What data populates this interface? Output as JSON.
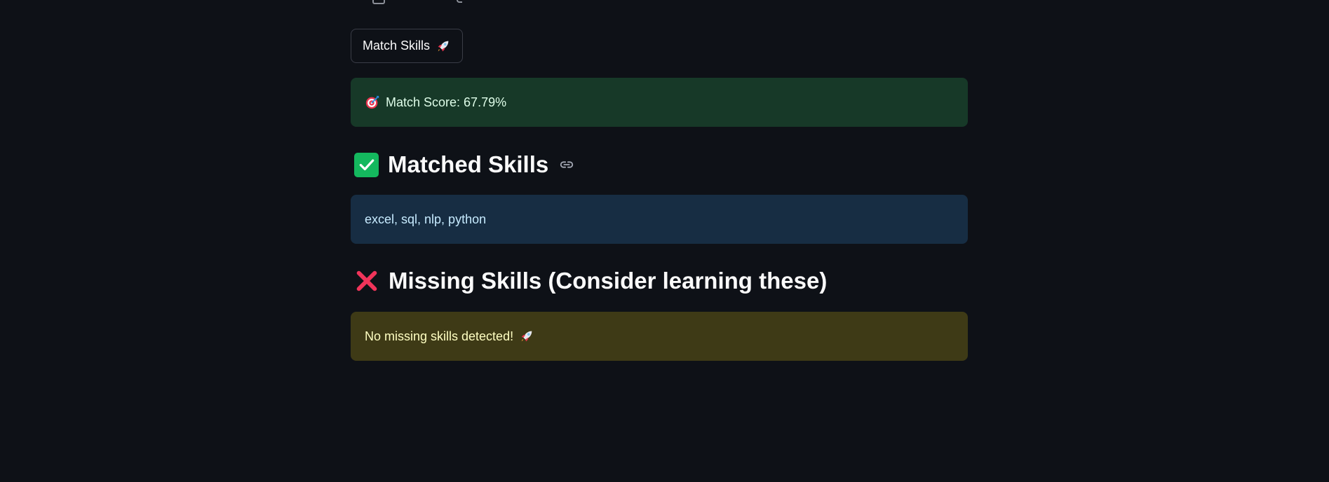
{
  "match_button": {
    "label": "Match Skills",
    "icon": "rocket-icon"
  },
  "score_alert": {
    "icon": "target-icon",
    "text": "Match Score: 67.79%"
  },
  "matched_section": {
    "icon": "check-mark-icon",
    "title": "Matched Skills",
    "anchor_icon": "link-icon",
    "skills_text": "excel, sql, nlp, python"
  },
  "missing_section": {
    "icon": "cross-mark-icon",
    "title": "Missing Skills (Consider learning these)",
    "message": "No missing skills detected!",
    "message_icon": "rocket-icon"
  },
  "colors": {
    "background": "#0e1117",
    "success_bg": "#173928",
    "info_bg": "#172d43",
    "warning_bg": "#3e3a16",
    "check_green": "#14b85e",
    "cross_red": "#f0345a"
  }
}
